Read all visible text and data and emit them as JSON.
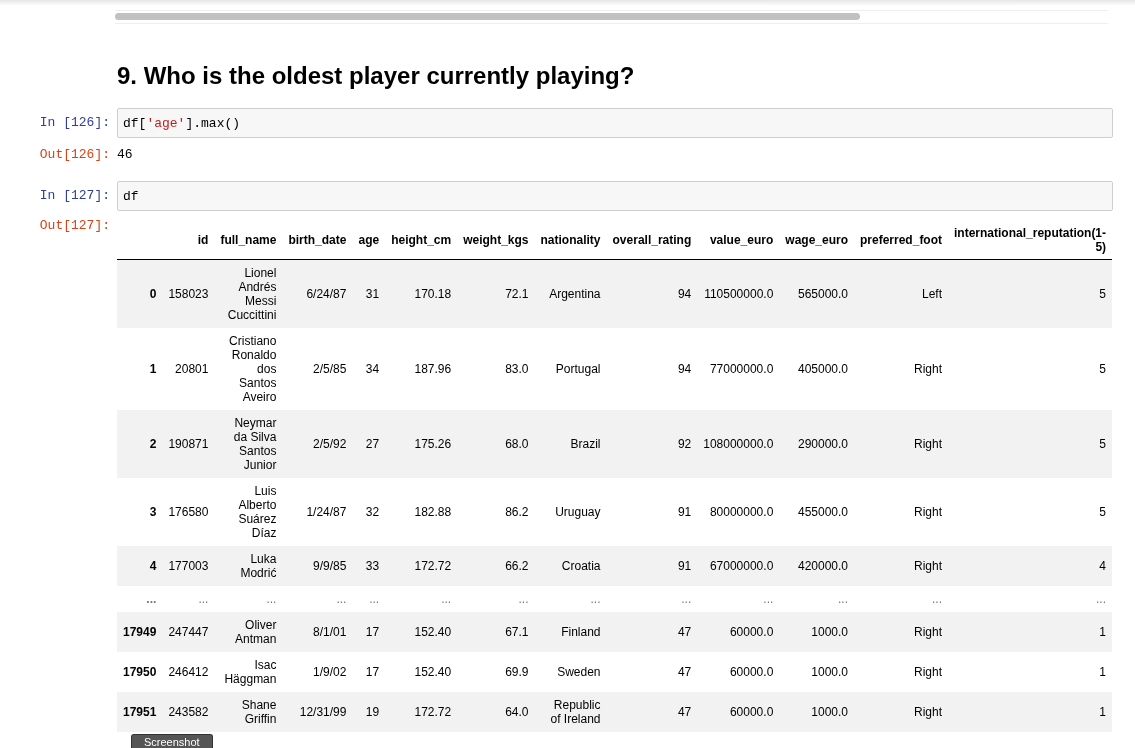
{
  "heading": "9. Who is the oldest player currently playing?",
  "cells": [
    {
      "prompt": "In [126]:",
      "code": [
        {
          "text": "df[",
          "kind": "plain"
        },
        {
          "text": "'age'",
          "kind": "string"
        },
        {
          "text": "].max()",
          "kind": "plain"
        }
      ],
      "output_prompt": "Out[126]:",
      "output": "46"
    },
    {
      "prompt": "In [127]:",
      "code": [
        {
          "text": "df",
          "kind": "plain"
        }
      ],
      "output_prompt": "Out[127]:"
    }
  ],
  "table": {
    "columns": [
      "",
      "id",
      "full_name",
      "birth_date",
      "age",
      "height_cm",
      "weight_kgs",
      "nationality",
      "overall_rating",
      "value_euro",
      "wage_euro",
      "preferred_foot",
      "international_reputation(1-5)"
    ],
    "rows": [
      {
        "kind": "data",
        "cells": [
          "0",
          "158023",
          "Lionel Andrés Messi Cuccittini",
          "6/24/87",
          "31",
          "170.18",
          "72.1",
          "Argentina",
          "94",
          "110500000.0",
          "565000.0",
          "Left",
          "5"
        ]
      },
      {
        "kind": "data",
        "cells": [
          "1",
          "20801",
          "Cristiano Ronaldo dos Santos Aveiro",
          "2/5/85",
          "34",
          "187.96",
          "83.0",
          "Portugal",
          "94",
          "77000000.0",
          "405000.0",
          "Right",
          "5"
        ]
      },
      {
        "kind": "data",
        "cells": [
          "2",
          "190871",
          "Neymar da Silva Santos Junior",
          "2/5/92",
          "27",
          "175.26",
          "68.0",
          "Brazil",
          "92",
          "108000000.0",
          "290000.0",
          "Right",
          "5"
        ]
      },
      {
        "kind": "data",
        "cells": [
          "3",
          "176580",
          "Luis Alberto Suárez Díaz",
          "1/24/87",
          "32",
          "182.88",
          "86.2",
          "Uruguay",
          "91",
          "80000000.0",
          "455000.0",
          "Right",
          "5"
        ]
      },
      {
        "kind": "data",
        "cells": [
          "4",
          "177003",
          "Luka Modrić",
          "9/9/85",
          "33",
          "172.72",
          "66.2",
          "Croatia",
          "91",
          "67000000.0",
          "420000.0",
          "Right",
          "4"
        ]
      },
      {
        "kind": "ellipsis",
        "cells": [
          "...",
          "...",
          "...",
          "...",
          "...",
          "...",
          "...",
          "...",
          "...",
          "...",
          "...",
          "...",
          "..."
        ]
      },
      {
        "kind": "data",
        "cells": [
          "17949",
          "247447",
          "Oliver Antman",
          "8/1/01",
          "17",
          "152.40",
          "67.1",
          "Finland",
          "47",
          "60000.0",
          "1000.0",
          "Right",
          "1"
        ]
      },
      {
        "kind": "data",
        "cells": [
          "17950",
          "246412",
          "Isac Häggman",
          "1/9/02",
          "17",
          "152.40",
          "69.9",
          "Sweden",
          "47",
          "60000.0",
          "1000.0",
          "Right",
          "1"
        ]
      },
      {
        "kind": "data",
        "cells": [
          "17951",
          "243582",
          "Shane Griffin",
          "12/31/99",
          "19",
          "172.72",
          "64.0",
          "Republic of Ireland",
          "47",
          "60000.0",
          "1000.0",
          "Right",
          "1"
        ]
      }
    ]
  },
  "screenshot_button": "Screenshot"
}
